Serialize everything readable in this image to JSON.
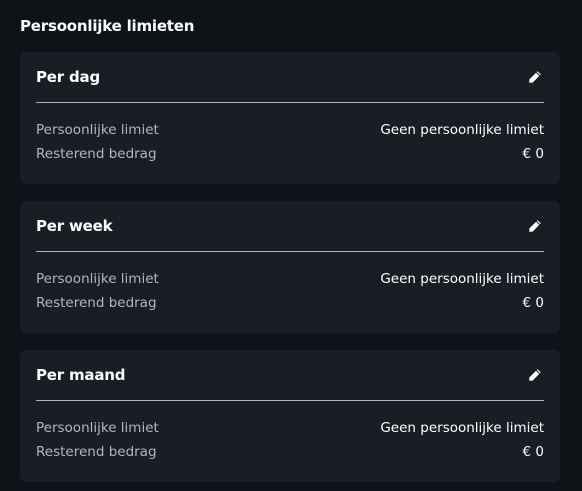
{
  "title": "Persoonlijke limieten",
  "cards": [
    {
      "title": "Per dag",
      "rows": [
        {
          "label": "Persoonlijke limiet",
          "value": "Geen persoonlijke limiet"
        },
        {
          "label": "Resterend bedrag",
          "value": "€ 0"
        }
      ]
    },
    {
      "title": "Per week",
      "rows": [
        {
          "label": "Persoonlijke limiet",
          "value": "Geen persoonlijke limiet"
        },
        {
          "label": "Resterend bedrag",
          "value": "€ 0"
        }
      ]
    },
    {
      "title": "Per maand",
      "rows": [
        {
          "label": "Persoonlijke limiet",
          "value": "Geen persoonlijke limiet"
        },
        {
          "label": "Resterend bedrag",
          "value": "€ 0"
        }
      ]
    }
  ],
  "icons": {
    "edit": "pencil-icon"
  },
  "colors": {
    "background": "#0f1317",
    "card": "#1a1e24",
    "label": "#b3b7bd",
    "value": "#ffffff"
  }
}
